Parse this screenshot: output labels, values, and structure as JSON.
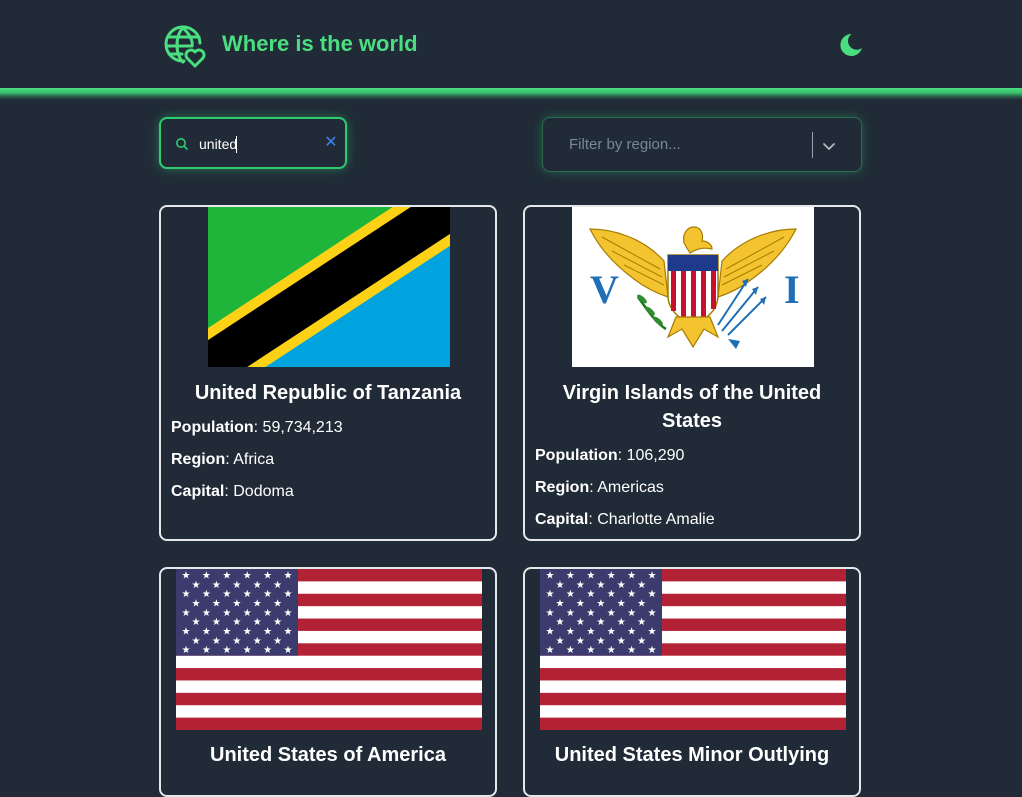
{
  "header": {
    "title": "Where is the world",
    "logo_icon": "globe-heart-icon",
    "theme_icon": "moon-icon",
    "accent_color": "#4ade80"
  },
  "search": {
    "value": "united",
    "icon": "search-icon",
    "clear_icon": "close-icon"
  },
  "filter": {
    "placeholder": "Filter by region...",
    "icon": "chevron-down-icon"
  },
  "labels": {
    "population": "Population",
    "region": "Region",
    "capital": "Capital"
  },
  "countries": [
    {
      "name": "United Republic of Tanzania",
      "population": "59,734,213",
      "region": "Africa",
      "capital": "Dodoma",
      "flag": "tanzania-flag"
    },
    {
      "name": "Virgin Islands of the United States",
      "population": "106,290",
      "region": "Americas",
      "capital": "Charlotte Amalie",
      "flag": "us-virgin-islands-flag"
    },
    {
      "name": "United States of America",
      "flag": "usa-flag"
    },
    {
      "name": "United States Minor Outlying",
      "flag": "usa-flag"
    }
  ]
}
